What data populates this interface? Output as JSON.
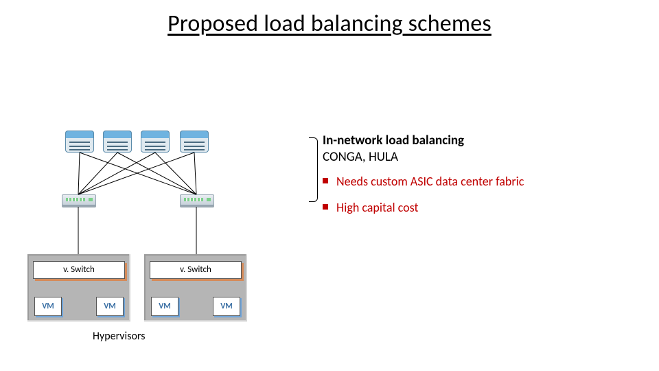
{
  "title": "Proposed load balancing schemes",
  "headline": {
    "bold": "In-network load balancing",
    "sub": "CONGA, HULA"
  },
  "bullets": [
    "Needs custom ASIC data center fabric",
    "High capital cost"
  ],
  "labels": {
    "vswitch": "v. Switch",
    "vm": "VM",
    "hypervisors": "Hypervisors"
  },
  "diagram": {
    "spine_switches": 4,
    "leaf_switches": 2,
    "hosts": 2,
    "vms_per_host": 2
  }
}
